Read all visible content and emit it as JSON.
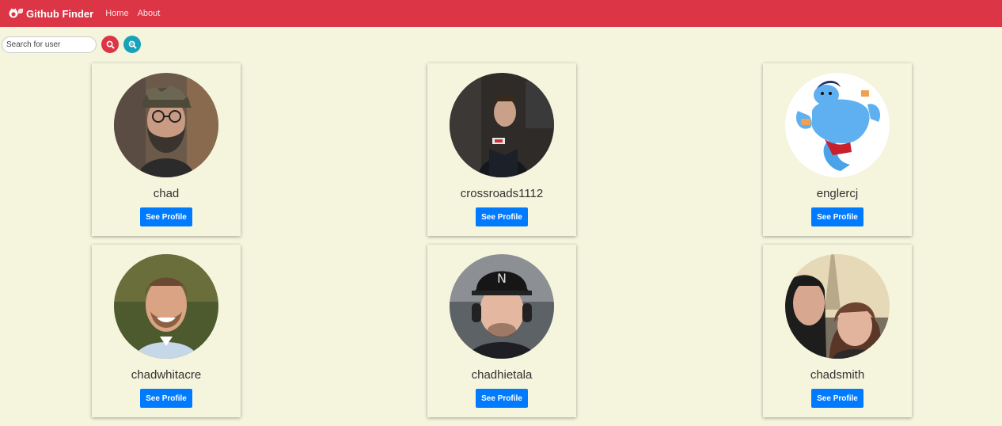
{
  "navbar": {
    "brand": "Github Finder",
    "links": [
      "Home",
      "About"
    ],
    "color": "#dc3545"
  },
  "search": {
    "placeholder": "Search for user",
    "value": ""
  },
  "users": [
    {
      "login": "chad",
      "button": "See Profile",
      "avatar_icon": "bearded-man-photo"
    },
    {
      "login": "crossroads1112",
      "button": "See Profile",
      "avatar_icon": "speaker-photo"
    },
    {
      "login": "englercj",
      "button": "See Profile",
      "avatar_icon": "genie-cartoon"
    },
    {
      "login": "chadwhitacre",
      "button": "See Profile",
      "avatar_icon": "smiling-man-photo"
    },
    {
      "login": "chadhietala",
      "button": "See Profile",
      "avatar_icon": "headphones-man-photo"
    },
    {
      "login": "chadsmith",
      "button": "See Profile",
      "avatar_icon": "couple-selfie-photo"
    }
  ]
}
